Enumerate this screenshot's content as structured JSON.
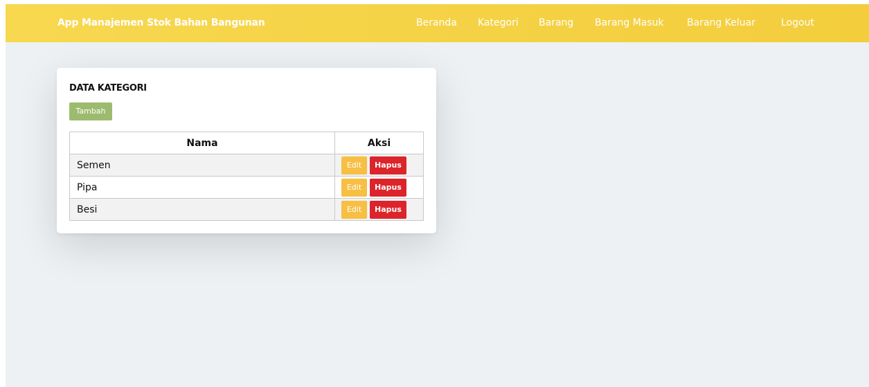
{
  "navbar": {
    "brand": "App Manajemen Stok Bahan Bangunan",
    "links": [
      "Beranda",
      "Kategori",
      "Barang",
      "Barang Masuk",
      "Barang Keluar",
      "Logout"
    ]
  },
  "card": {
    "title": "DATA KATEGORI",
    "add_label": "Tambah",
    "columns": [
      "Nama",
      "Aksi"
    ],
    "rows": [
      {
        "nama": "Semen",
        "edit": "Edit",
        "hapus": "Hapus"
      },
      {
        "nama": "Pipa",
        "edit": "Edit",
        "hapus": "Hapus"
      },
      {
        "nama": "Besi",
        "edit": "Edit",
        "hapus": "Hapus"
      }
    ]
  },
  "colors": {
    "navbar": "#f5d143",
    "background": "#edf1f4",
    "add_button": "#9dbb6e",
    "edit_button": "#f7bf43",
    "delete_button": "#dc242b"
  }
}
